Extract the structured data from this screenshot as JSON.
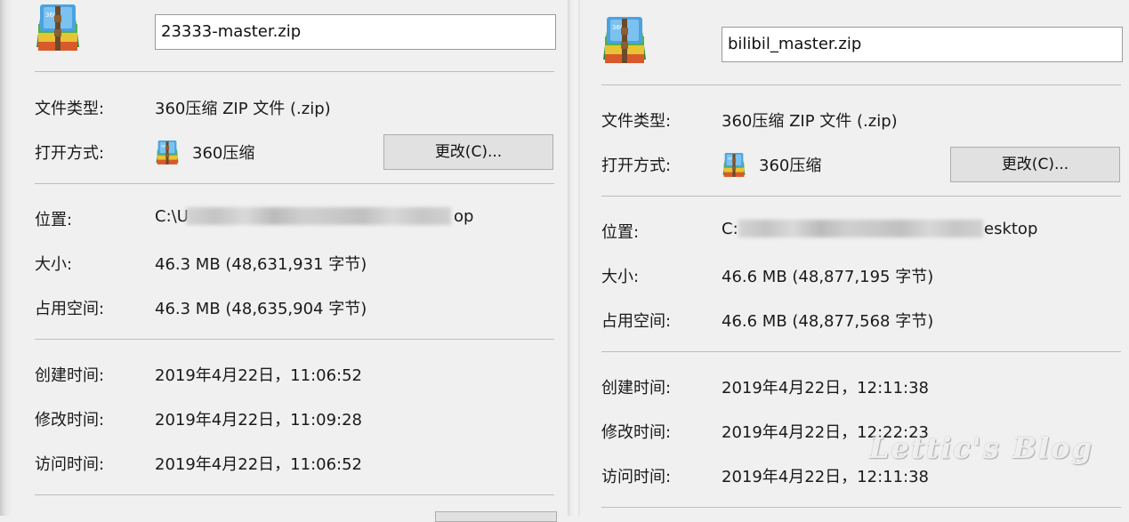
{
  "left": {
    "file_name": "23333-master.zip",
    "labels": {
      "file_type": "文件类型:",
      "open_with": "打开方式:",
      "location": "位置:",
      "size": "大小:",
      "size_on_disk": "占用空间:",
      "created": "创建时间:",
      "modified": "修改时间:",
      "accessed": "访问时间:"
    },
    "file_type": "360压缩 ZIP 文件 (.zip)",
    "open_with_app": "360压缩",
    "change_button": "更改(C)...",
    "location_prefix": "C:\\U",
    "location_suffix": "op",
    "size": "46.3 MB (48,631,931 字节)",
    "size_on_disk": "46.3 MB (48,635,904 字节)",
    "created": "2019年4月22日，11:06:52",
    "modified": "2019年4月22日，11:09:28",
    "accessed": "2019年4月22日，11:06:52"
  },
  "right": {
    "file_name": "bilibil_master.zip",
    "labels": {
      "file_type": "文件类型:",
      "open_with": "打开方式:",
      "location": "位置:",
      "size": "大小:",
      "size_on_disk": "占用空间:",
      "created": "创建时间:",
      "modified": "修改时间:",
      "accessed": "访问时间:"
    },
    "file_type": "360压缩 ZIP 文件 (.zip)",
    "open_with_app": "360压缩",
    "change_button": "更改(C)...",
    "location_prefix": "C:",
    "location_suffix": "esktop",
    "size": "46.6 MB (48,877,195 字节)",
    "size_on_disk": "46.6 MB (48,877,568 字节)",
    "created": "2019年4月22日，12:11:38",
    "modified": "2019年4月22日，12:22:23",
    "accessed": "2019年4月22日，12:11:38"
  },
  "watermark": "Lettic's Blog",
  "icons": {
    "archive": "winrar-archive-icon",
    "app": "360zip-icon"
  }
}
